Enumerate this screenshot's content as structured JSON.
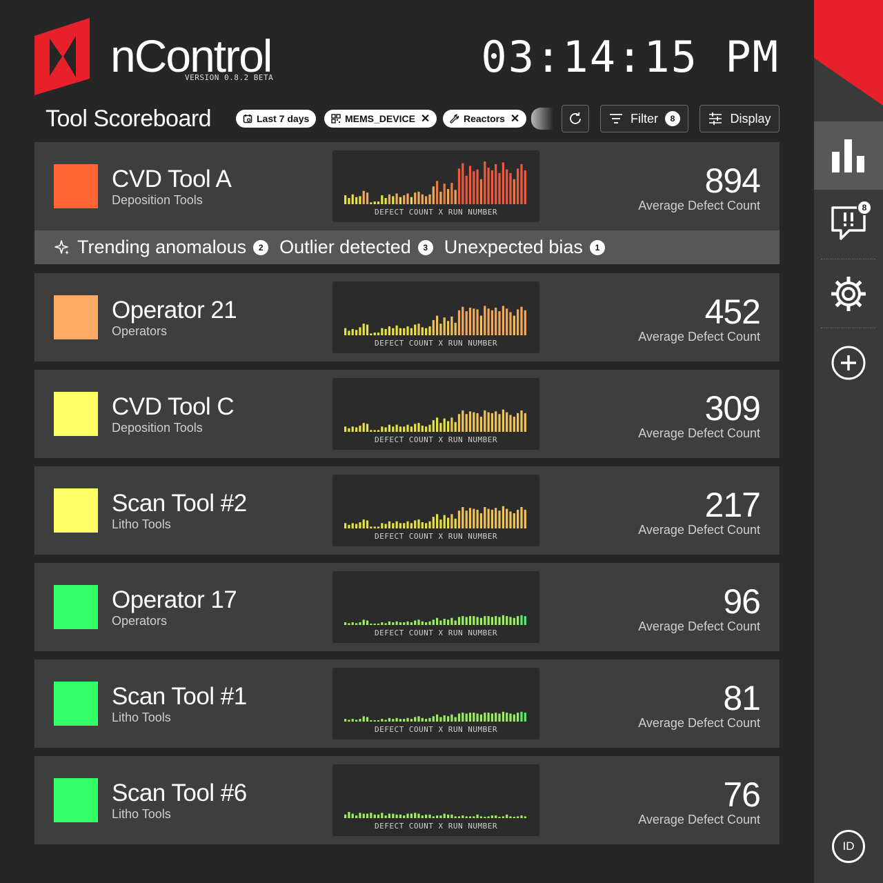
{
  "header": {
    "brand": "nControl",
    "version": "VERSION 0.8.2 BETA",
    "clock": "03:14:15 PM",
    "brand_color": "#e8202a"
  },
  "toolbar": {
    "title": "Tool Scoreboard",
    "chips": [
      {
        "label": "Last 7 days",
        "icon": "calendar-icon"
      },
      {
        "label": "MEMS_DEVICE",
        "icon": "qr-icon",
        "removable": true
      },
      {
        "label": "Reactors",
        "icon": "wrench-icon",
        "removable": true
      }
    ],
    "refresh_icon": "refresh-icon",
    "filter_label": "Filter",
    "filter_count": "8",
    "display_label": "Display"
  },
  "anomalies": {
    "items": [
      {
        "label": "Trending anomalous",
        "count": "2",
        "icon": "sparkle-icon"
      },
      {
        "label": "Outlier detected",
        "count": "3"
      },
      {
        "label": "Unexpected bias",
        "count": "1"
      }
    ]
  },
  "spark_label": "DEFECT COUNT X RUN NUMBER",
  "value_label": "Average Defect Count",
  "rows": [
    {
      "name": "CVD Tool A",
      "category": "Deposition Tools",
      "value": "894",
      "color": "#ff6633",
      "bars": [
        10,
        7,
        11,
        8,
        9,
        15,
        13,
        2,
        3,
        3,
        10,
        7,
        11,
        9,
        12,
        8,
        10,
        12,
        8,
        13,
        14,
        11,
        9,
        11,
        20,
        26,
        14,
        23,
        17,
        24,
        16,
        40,
        46,
        32,
        43,
        37,
        39,
        28,
        48,
        41,
        38,
        45,
        35,
        47,
        39,
        35,
        28,
        40,
        45,
        38
      ],
      "colors": [
        "#e8e23e",
        "#f2a85a",
        "#f07a3e",
        "#f05a3a"
      ]
    },
    {
      "name": "Operator 21",
      "category": "Operators",
      "value": "452",
      "color": "#ffaa66",
      "bars": [
        8,
        5,
        7,
        6,
        9,
        13,
        12,
        2,
        3,
        3,
        8,
        7,
        10,
        8,
        11,
        8,
        8,
        10,
        8,
        12,
        13,
        9,
        8,
        10,
        17,
        22,
        13,
        20,
        16,
        21,
        14,
        28,
        32,
        27,
        31,
        30,
        29,
        22,
        33,
        30,
        28,
        31,
        27,
        33,
        30,
        26,
        22,
        29,
        32,
        28
      ],
      "colors": [
        "#e8e23e",
        "#f0c25a",
        "#f2a85a"
      ]
    },
    {
      "name": "CVD Tool C",
      "category": "Deposition Tools",
      "value": "309",
      "color": "#ffff66",
      "bars": [
        6,
        4,
        6,
        5,
        7,
        10,
        9,
        2,
        2,
        2,
        6,
        5,
        8,
        6,
        8,
        6,
        6,
        8,
        6,
        9,
        10,
        7,
        6,
        8,
        13,
        16,
        10,
        15,
        12,
        16,
        11,
        20,
        24,
        20,
        23,
        22,
        21,
        17,
        24,
        22,
        21,
        23,
        20,
        25,
        22,
        19,
        17,
        21,
        24,
        21
      ],
      "colors": [
        "#e8e23e",
        "#f0c25a"
      ]
    },
    {
      "name": "Scan Tool #2",
      "category": "Litho Tools",
      "value": "217",
      "color": "#ffff66",
      "bars": [
        6,
        4,
        6,
        5,
        7,
        10,
        9,
        2,
        2,
        2,
        6,
        5,
        8,
        6,
        8,
        6,
        6,
        8,
        6,
        9,
        10,
        7,
        6,
        8,
        13,
        16,
        10,
        15,
        12,
        16,
        11,
        20,
        24,
        20,
        23,
        22,
        21,
        17,
        24,
        22,
        21,
        23,
        20,
        25,
        22,
        19,
        17,
        21,
        24,
        21
      ],
      "colors": [
        "#e8e23e",
        "#f0c25a"
      ]
    },
    {
      "name": "Operator 17",
      "category": "Operators",
      "value": "96",
      "color": "#33ff66",
      "bars": [
        3,
        2,
        3,
        2,
        3,
        6,
        5,
        1,
        1,
        1,
        3,
        2,
        4,
        3,
        4,
        3,
        3,
        4,
        3,
        5,
        6,
        4,
        3,
        4,
        6,
        8,
        5,
        7,
        6,
        8,
        5,
        9,
        10,
        9,
        10,
        10,
        9,
        8,
        10,
        10,
        9,
        10,
        9,
        11,
        10,
        9,
        8,
        10,
        11,
        10
      ],
      "colors": [
        "#9aef5a",
        "#55f06a"
      ]
    },
    {
      "name": "Scan Tool #1",
      "category": "Litho Tools",
      "value": "81",
      "color": "#33ff66",
      "bars": [
        3,
        2,
        3,
        2,
        3,
        6,
        5,
        1,
        1,
        1,
        3,
        2,
        4,
        3,
        4,
        3,
        3,
        4,
        3,
        5,
        6,
        4,
        3,
        4,
        6,
        8,
        5,
        7,
        6,
        8,
        5,
        9,
        10,
        9,
        10,
        10,
        9,
        8,
        10,
        10,
        9,
        10,
        9,
        11,
        10,
        9,
        8,
        10,
        11,
        10
      ],
      "colors": [
        "#9aef5a",
        "#55f06a"
      ]
    },
    {
      "name": "Scan Tool #6",
      "category": "Litho Tools",
      "value": "76",
      "color": "#33ff66",
      "bars": [
        4,
        7,
        5,
        3,
        6,
        5,
        5,
        6,
        4,
        4,
        6,
        3,
        5,
        5,
        4,
        4,
        3,
        5,
        5,
        6,
        5,
        3,
        4,
        4,
        2,
        3,
        3,
        5,
        4,
        4,
        2,
        2,
        3,
        2,
        2,
        2,
        4,
        2,
        1,
        2,
        3,
        3,
        1,
        2,
        4,
        2,
        1,
        2,
        3,
        2
      ],
      "colors": [
        "#9aef5a",
        "#55f06a"
      ]
    }
  ],
  "rail": {
    "items": [
      {
        "icon": "bar-chart-icon",
        "active": true
      },
      {
        "icon": "alert-message-icon",
        "badge": "8"
      },
      {
        "icon": "gear-icon"
      },
      {
        "icon": "add-circle-icon"
      }
    ],
    "user_initials": "ID"
  }
}
